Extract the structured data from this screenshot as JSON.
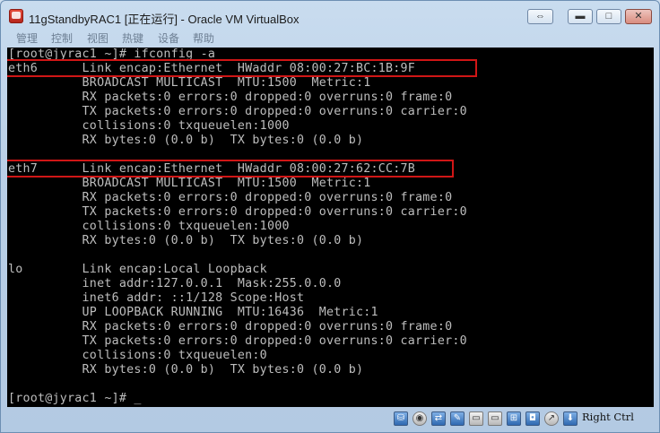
{
  "window": {
    "title": "11gStandbyRAC1 [正在运行] - Oracle VM VirtualBox",
    "controls": {
      "restore": "⇔",
      "minimize": "▬",
      "maximize": "□",
      "close": "✕"
    }
  },
  "menu": {
    "items": [
      {
        "label": "管理"
      },
      {
        "label": "控制"
      },
      {
        "label": "视图"
      },
      {
        "label": "热键"
      },
      {
        "label": "设备"
      },
      {
        "label": "帮助"
      }
    ]
  },
  "terminal": {
    "lines": [
      "[root@jyrac1 ~]# ifconfig -a",
      "eth6      Link encap:Ethernet  HWaddr 08:00:27:BC:1B:9F",
      "          BROADCAST MULTICAST  MTU:1500  Metric:1",
      "          RX packets:0 errors:0 dropped:0 overruns:0 frame:0",
      "          TX packets:0 errors:0 dropped:0 overruns:0 carrier:0",
      "          collisions:0 txqueuelen:1000",
      "          RX bytes:0 (0.0 b)  TX bytes:0 (0.0 b)",
      "",
      "eth7      Link encap:Ethernet  HWaddr 08:00:27:62:CC:7B",
      "          BROADCAST MULTICAST  MTU:1500  Metric:1",
      "          RX packets:0 errors:0 dropped:0 overruns:0 frame:0",
      "          TX packets:0 errors:0 dropped:0 overruns:0 carrier:0",
      "          collisions:0 txqueuelen:1000",
      "          RX bytes:0 (0.0 b)  TX bytes:0 (0.0 b)",
      "",
      "lo        Link encap:Local Loopback",
      "          inet addr:127.0.0.1  Mask:255.0.0.0",
      "          inet6 addr: ::1/128 Scope:Host",
      "          UP LOOPBACK RUNNING  MTU:16436  Metric:1",
      "          RX packets:0 errors:0 dropped:0 overruns:0 frame:0",
      "          TX packets:0 errors:0 dropped:0 overruns:0 carrier:0",
      "          collisions:0 txqueuelen:0",
      "          RX bytes:0 (0.0 b)  TX bytes:0 (0.0 b)",
      "",
      "[root@jyrac1 ~]# _"
    ],
    "text_color": "#bdbdbd",
    "background": "#000000",
    "highlight_color": "#d01616"
  },
  "statusbar": {
    "icons": [
      "hard-disk-icon",
      "optical-drive-icon",
      "usb-icon",
      "pencil-icon",
      "folder-icon",
      "display-icon",
      "network-icon",
      "video-capture-icon",
      "mouse-integration-icon",
      "download-arrow-icon"
    ],
    "host_key": "Right Ctrl"
  }
}
